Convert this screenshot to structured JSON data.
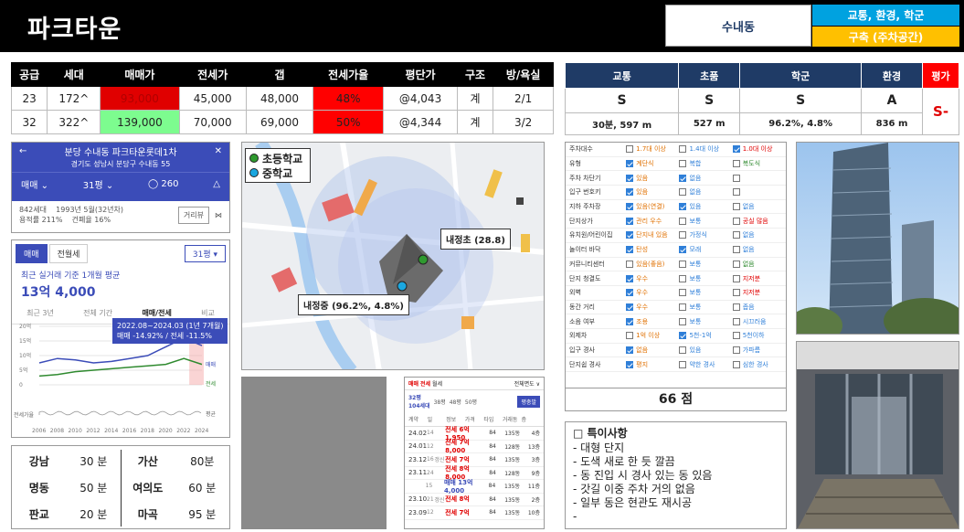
{
  "header": {
    "title": "파크타운",
    "area": "수내동",
    "tag_primary": "교통, 환경, 학군",
    "tag_secondary": "구축 (주차공간)"
  },
  "supply_table": {
    "columns": [
      "공급",
      "세대",
      "매매가",
      "전세가",
      "갭",
      "전세가율",
      "평단가",
      "구조",
      "방/욕실"
    ],
    "rows": [
      [
        "23",
        "172^",
        "93,000",
        "45,000",
        "48,000",
        "48%",
        "@4,043",
        "계",
        "2/1"
      ],
      [
        "32",
        "322^",
        "139,000",
        "70,000",
        "69,000",
        "50%",
        "@4,344",
        "계",
        "3/2"
      ]
    ]
  },
  "grade_table": {
    "columns": [
      "교통",
      "초품",
      "학군",
      "환경",
      "평가"
    ],
    "grades": [
      "S",
      "S",
      "S",
      "A"
    ],
    "details": [
      "30분, 597 m",
      "527 m",
      "96.2%, 4.8%",
      "836 m"
    ],
    "evaluation": "S-"
  },
  "app_header": {
    "title": "분당 수내동 파크타운롯데1차",
    "address": "경기도 성남시 분당구 수내동 55",
    "deal": "매매",
    "size": "31평",
    "comments": "260",
    "households": "842세대",
    "built": "1993년 5월(32년차)",
    "floor_area": "용적률 211%",
    "coverage": "건폐율 16%",
    "view_button": "거리뷰"
  },
  "price_app": {
    "tab_sale": "매매",
    "tab_lease": "전월세",
    "size_select": "31평",
    "subtitle": "최근 실거래 기준 1개월 평균",
    "price": "13억 4,000",
    "range_tabs": [
      "최근 3년",
      "전체 기간",
      "매매/전세",
      "비교"
    ],
    "tooltip_line1": "2022.08~2024.03 (1년 7개월)",
    "tooltip_line2": "매매 -14.92% / 전세 -11.5%",
    "y_ticks": [
      "20억",
      "15억",
      "10억",
      "5억",
      "0"
    ],
    "x_ticks": [
      "2006",
      "2008",
      "2010",
      "2012",
      "2014",
      "2016",
      "2018",
      "2020",
      "2022",
      "2024"
    ],
    "lbl_sale": "매매",
    "lbl_lease": "전세",
    "lbl_volume": "전세가율",
    "lbl_avg": "평균"
  },
  "chart_data": {
    "type": "line",
    "x": [
      2006,
      2008,
      2010,
      2012,
      2014,
      2016,
      2018,
      2020,
      2022,
      2024
    ],
    "series": [
      {
        "name": "매매",
        "values": [
          7.5,
          9,
          8.5,
          7.5,
          8,
          9,
          10,
          13,
          16,
          13.4
        ]
      },
      {
        "name": "전세",
        "values": [
          3,
          3.5,
          4.5,
          5,
          5.5,
          6,
          6.5,
          7,
          9,
          7
        ]
      }
    ],
    "ylim": [
      0,
      20
    ]
  },
  "commute": [
    {
      "place": "강남",
      "time": "30 분"
    },
    {
      "place": "가산",
      "time": "80분"
    },
    {
      "place": "명동",
      "time": "50 분"
    },
    {
      "place": "여의도",
      "time": "60 분"
    },
    {
      "place": "판교",
      "time": "20 분"
    },
    {
      "place": "마곡",
      "time": "95 분"
    }
  ],
  "map": {
    "legend_elem": "초등학교",
    "legend_mid": "중학교",
    "label_elem": "내정초 (28.8)",
    "label_mid": "내정중 (96.2%, 4.8%)",
    "colors": {
      "elem": "#2f9a2f",
      "mid": "#1aa7e0"
    }
  },
  "trade_app": {
    "top": [
      "매매",
      "전세",
      "월세",
      "전체면도 ∨"
    ],
    "types": [
      "32평",
      "38평",
      "48평",
      "50평"
    ],
    "households_line": "104세대",
    "button": "평충발",
    "headers": [
      "계약",
      "일",
      "정보",
      "가격",
      "타입",
      "거래동",
      "층"
    ],
    "rows": [
      [
        "24.02",
        "14",
        "",
        "전세 6억 1,950",
        "84",
        "135동",
        "4층"
      ],
      [
        "24.01",
        "12",
        "",
        "전세 7억 8,000",
        "84",
        "128동",
        "13층"
      ],
      [
        "23.12",
        "16",
        "갱신",
        "전세 7억",
        "84",
        "135동",
        "3층"
      ],
      [
        "23.11",
        "24",
        "",
        "전세 8억 8,000",
        "84",
        "128동",
        "9층"
      ],
      [
        "",
        "15",
        "",
        "매매 13억 4,000",
        "84",
        "135동",
        "11층"
      ],
      [
        "23.10",
        "21",
        "갱신",
        "전세 8억",
        "84",
        "135동",
        "2층"
      ],
      [
        "23.09",
        "12",
        "",
        "전세 7억",
        "84",
        "135동",
        "10층"
      ]
    ]
  },
  "checklist": {
    "rows": [
      {
        "label": "주차대수",
        "opts": [
          [
            "1.7대 이상",
            false,
            "orange"
          ],
          [
            "1.4대 이상",
            false,
            "blue"
          ],
          [
            "1.0대 이상",
            true,
            "red"
          ]
        ]
      },
      {
        "label": "유형",
        "opts": [
          [
            "계단식",
            true,
            "orange"
          ],
          [
            "복합",
            false,
            "blue"
          ],
          [
            "복도식",
            false,
            "green"
          ]
        ]
      },
      {
        "label": "주차 차단기",
        "opts": [
          [
            "있음",
            true,
            "orange"
          ],
          [
            "없음",
            true,
            "blue"
          ],
          [
            "",
            false,
            "blue"
          ]
        ]
      },
      {
        "label": "입구 번호키",
        "opts": [
          [
            "있음",
            true,
            "orange"
          ],
          [
            "없음",
            false,
            "blue"
          ],
          [
            "",
            false,
            "blue"
          ]
        ]
      },
      {
        "label": "지하 주차장",
        "opts": [
          [
            "있음(연결)",
            true,
            "orange"
          ],
          [
            "있음",
            true,
            "blue"
          ],
          [
            "없음",
            false,
            "blue"
          ]
        ]
      },
      {
        "label": "단지상가",
        "opts": [
          [
            "관리 우수",
            true,
            "orange"
          ],
          [
            "보통",
            false,
            "blue"
          ],
          [
            "공실 많음",
            false,
            "red"
          ]
        ]
      },
      {
        "label": "유치원/어린이집",
        "opts": [
          [
            "단지내 있음",
            true,
            "orange"
          ],
          [
            "가정식",
            false,
            "blue"
          ],
          [
            "없음",
            false,
            "blue"
          ]
        ]
      },
      {
        "label": "놀이터 바닥",
        "opts": [
          [
            "탄성",
            true,
            "orange"
          ],
          [
            "모래",
            true,
            "blue"
          ],
          [
            "없음",
            false,
            "blue"
          ]
        ]
      },
      {
        "label": "커뮤니티센터",
        "opts": [
          [
            "있음(좋음)",
            false,
            "orange"
          ],
          [
            "보통",
            false,
            "blue"
          ],
          [
            "없음",
            false,
            "green"
          ]
        ]
      },
      {
        "label": "단지 청결도",
        "opts": [
          [
            "우수",
            true,
            "orange"
          ],
          [
            "보통",
            false,
            "blue"
          ],
          [
            "지저분",
            false,
            "red"
          ]
        ]
      },
      {
        "label": "외벽",
        "opts": [
          [
            "우수",
            true,
            "orange"
          ],
          [
            "보통",
            false,
            "blue"
          ],
          [
            "지저분",
            false,
            "red"
          ]
        ]
      },
      {
        "label": "동간 거리",
        "opts": [
          [
            "우수",
            true,
            "orange"
          ],
          [
            "보통",
            false,
            "blue"
          ],
          [
            "좁음",
            false,
            "blue"
          ]
        ]
      },
      {
        "label": "소음 여부",
        "opts": [
          [
            "조용",
            true,
            "orange"
          ],
          [
            "보통",
            false,
            "blue"
          ],
          [
            "시끄러움",
            false,
            "blue"
          ]
        ]
      },
      {
        "label": "외제차",
        "opts": [
          [
            "1억 이상",
            false,
            "orange"
          ],
          [
            "5천-1억",
            true,
            "blue"
          ],
          [
            "5천이하",
            false,
            "blue"
          ]
        ]
      },
      {
        "label": "입구 경사",
        "opts": [
          [
            "없음",
            true,
            "orange"
          ],
          [
            "있음",
            false,
            "blue"
          ],
          [
            "가파름",
            false,
            "blue"
          ]
        ]
      },
      {
        "label": "단지쉽 경사",
        "opts": [
          [
            "평지",
            true,
            "orange"
          ],
          [
            "약한 경사",
            false,
            "blue"
          ],
          [
            "심한 경사",
            false,
            "blue"
          ]
        ]
      }
    ],
    "score": "66 점"
  },
  "notes": {
    "title": "□ 특이사항",
    "lines": [
      "- 대형 단지",
      "- 도색 새로 한 듯 깔끔",
      "- 동 진입 시 경사 있는 동 있음",
      "- 갓길 이중 주차 거의 없음",
      "- 일부 동은 현관도 재시공",
      "-"
    ]
  }
}
